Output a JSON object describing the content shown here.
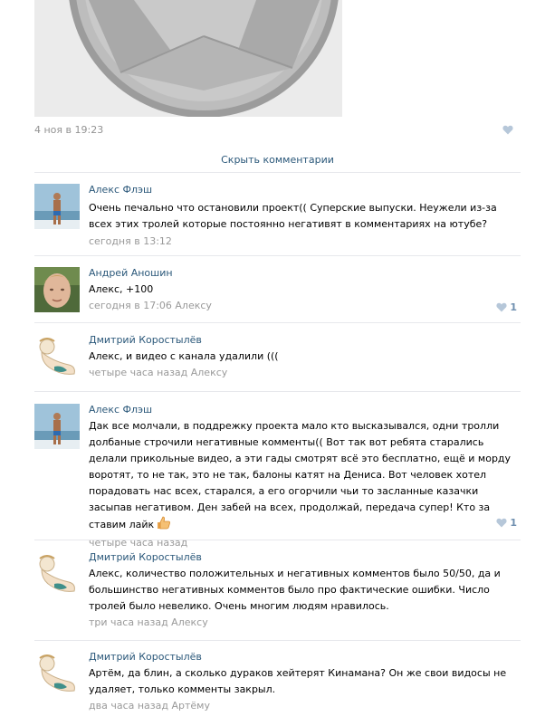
{
  "post": {
    "date": "4 ноя в 19:23"
  },
  "hide_comments_label": "Скрыть комментарии",
  "comments": [
    {
      "author": "Алекс Флэш",
      "text": "Очень печально что остановили проект(( Суперские выпуски. Неужели из-за всех этих тролей которые постоянно негативят в комментариях на ютубе?",
      "time": "сегодня в 13:12",
      "likes": ""
    },
    {
      "author": "Андрей Аношин",
      "text": "Алекс, +100",
      "time": "сегодня в 17:06 Алексу",
      "likes": "1"
    },
    {
      "author": "Дмитрий Коростылёв",
      "text": "Алекс, и видео с канала удалили (((",
      "time": "четыре часа назад Алексу",
      "likes": ""
    },
    {
      "author": "Алекс Флэш",
      "text": "Дак все молчали, в поддрежку проекта мало кто высказывался, одни тролли долбаные строчили негативные комменты(( Вот так вот ребята старались делали прикольные видео, а эти гады смотрят всё это бесплатно, ещё и морду воротят, то не так, это не так, балоны катят на Дениса. Вот человек хотел порадовать нас всех, старался, а его огорчили чьи то засланные казачки засыпав негативом. Ден забей на всех, продолжай, передача супер! Кто за ставим лайк",
      "time": "четыре часа назад",
      "likes": "1"
    },
    {
      "author": "Дмитрий Коростылёв",
      "text": "Алекс, количество положительных и негативных комментов было 50/50, да и большинство негативных комментов было про фактические ошибки. Число тролей было невелико. Очень многим людям нравилось.",
      "time": "три часа назад Алексу",
      "likes": ""
    },
    {
      "author": "Дмитрий Коростылёв",
      "text": "Артём, да блин, а сколько дураков хейтерят Кинамана? Он же свои видосы не удаляет, только комменты закрыл.",
      "time": "два часа назад Артёму",
      "likes": ""
    }
  ],
  "colors": {
    "link": "#2b587a",
    "meta": "#999999",
    "like": "#7090b0",
    "divider": "#e7e8ec"
  }
}
